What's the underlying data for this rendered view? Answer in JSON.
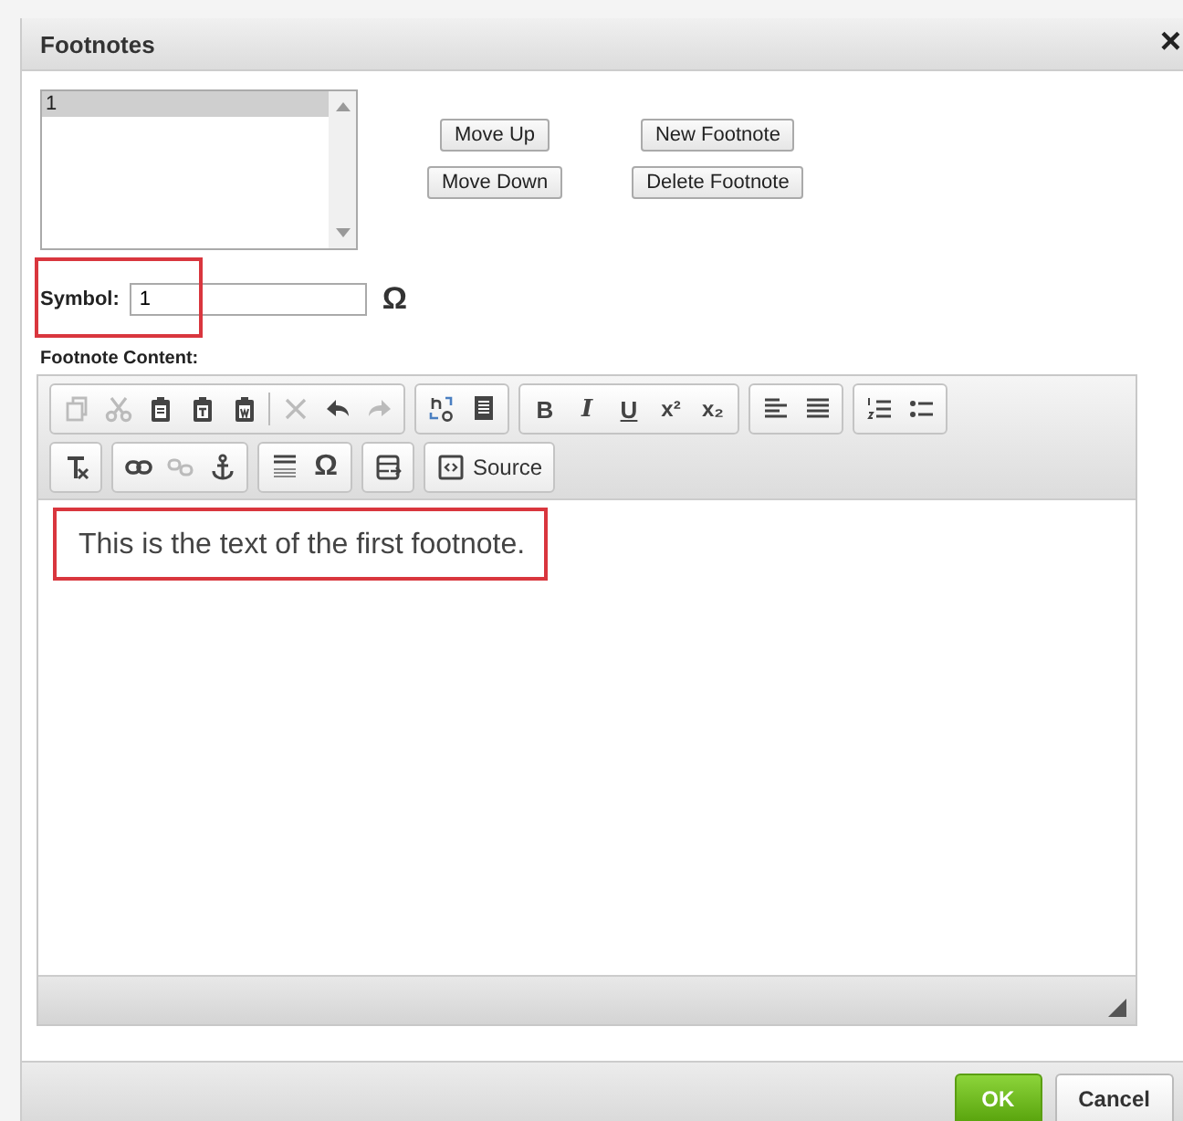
{
  "dialog": {
    "title": "Footnotes",
    "close": "×"
  },
  "footnote_list": {
    "items": [
      {
        "label": "1",
        "selected": true
      }
    ]
  },
  "list_buttons": [
    [
      {
        "label": "Move Up"
      },
      {
        "label": "Move Down"
      }
    ],
    [
      {
        "label": "New Footnote"
      },
      {
        "label": "Delete Footnote"
      }
    ]
  ],
  "symbol": {
    "label": "Symbol:",
    "value": "1",
    "symbol_button": "Ω",
    "highlighted": true
  },
  "content_label": "Footnote Content:",
  "toolbar": [
    [
      [
        {
          "kind": "copy",
          "disabled": true
        },
        {
          "kind": "cut",
          "disabled": true
        },
        {
          "kind": "paste",
          "disabled": false
        },
        {
          "kind": "pastetext",
          "disabled": false
        },
        {
          "kind": "pasteword",
          "disabled": false
        },
        {
          "kind": "delete",
          "disabled": true
        },
        {
          "kind": "undo",
          "disabled": false
        },
        {
          "kind": "redo",
          "disabled": true
        }
      ],
      [
        {
          "kind": "replace",
          "disabled": false
        },
        {
          "kind": "selectall",
          "disabled": false
        }
      ],
      [
        {
          "kind": "bold",
          "label": "B",
          "disabled": false
        },
        {
          "kind": "italic",
          "label": "I",
          "disabled": false
        },
        {
          "kind": "underline",
          "label": "U",
          "disabled": false
        },
        {
          "kind": "sup",
          "label": "x²",
          "disabled": false
        },
        {
          "kind": "sub",
          "label": "x₂",
          "disabled": false
        }
      ],
      [
        {
          "kind": "alignleft",
          "disabled": false
        },
        {
          "kind": "justify",
          "disabled": false
        }
      ],
      [
        {
          "kind": "numbered",
          "disabled": false
        },
        {
          "kind": "bulleted",
          "disabled": false
        }
      ]
    ],
    [
      [
        {
          "kind": "clearformat",
          "disabled": false
        }
      ],
      [
        {
          "kind": "link",
          "disabled": false
        },
        {
          "kind": "unlink",
          "disabled": true
        },
        {
          "kind": "anchor",
          "disabled": false
        }
      ],
      [
        {
          "kind": "rule",
          "disabled": false
        },
        {
          "kind": "symbol",
          "label": "Ω",
          "disabled": false
        }
      ],
      [
        {
          "kind": "template",
          "disabled": false
        }
      ],
      [
        {
          "kind": "source",
          "label": "Source",
          "disabled": false
        }
      ]
    ]
  ],
  "content": {
    "text": "This is the text of the first footnote.",
    "highlighted": true
  },
  "footer_buttons": [
    {
      "label": "OK",
      "kind": "primary"
    },
    {
      "label": "Cancel",
      "kind": "secondary"
    }
  ]
}
